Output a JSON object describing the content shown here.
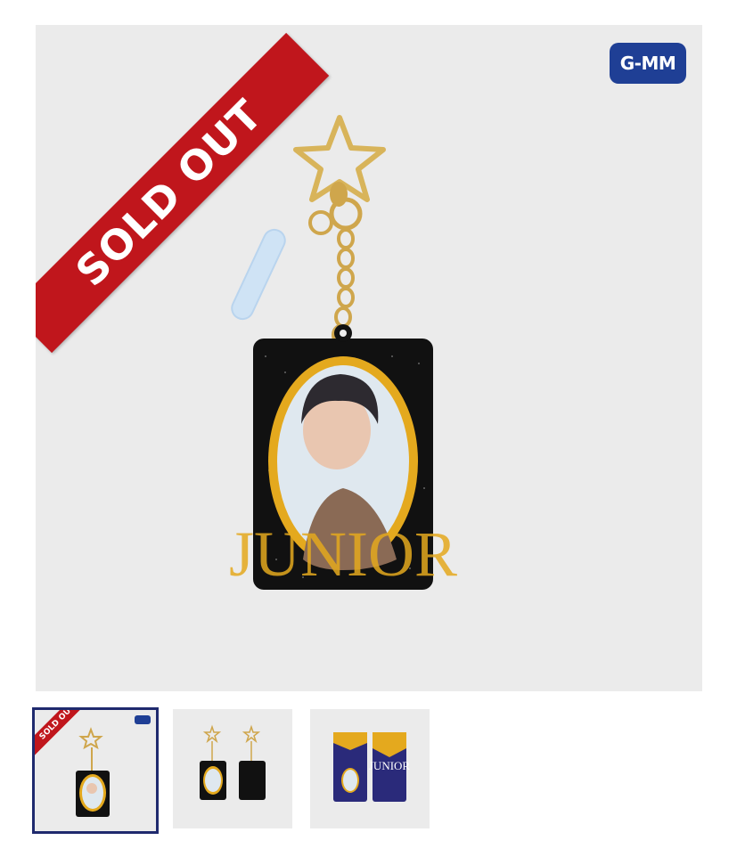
{
  "product_image": {
    "ribbon_text": "SOLD OUT",
    "brand_logo": "G-MM",
    "card_text": "JUNIOR",
    "colors": {
      "background": "#ebebeb",
      "ribbon": "#c0161c",
      "brand": "#1f3f95",
      "gold": "#e4a91e",
      "card": "#111111"
    }
  },
  "thumbnails": [
    {
      "label": "thumbnail-1",
      "ribbon": "SOLD OUT",
      "selected": true
    },
    {
      "label": "thumbnail-2",
      "selected": false
    },
    {
      "label": "thumbnail-3",
      "card_text": "JUNIOR",
      "selected": false
    }
  ]
}
